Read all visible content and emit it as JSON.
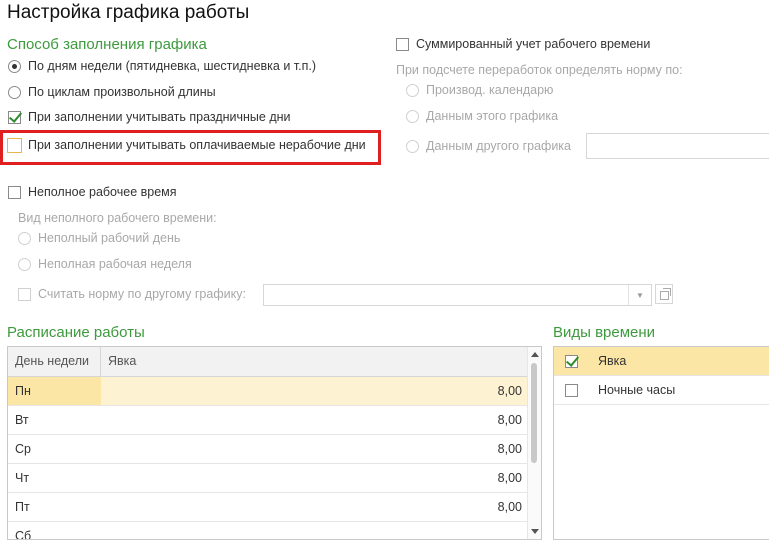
{
  "page": {
    "title": "Настройка графика работы"
  },
  "fill_method": {
    "heading": "Способ заполнения графика",
    "options": [
      {
        "label": "По дням недели (пятидневка, шестидневка и т.п.)",
        "selected": true
      },
      {
        "label": "По циклам произвольной длины",
        "selected": false
      }
    ],
    "holidays_checkbox": {
      "label": "При заполнении учитывать праздничные дни",
      "checked": true
    },
    "paid_nonworking_checkbox": {
      "label": "При заполнении учитывать оплачиваемые нерабочие дни",
      "checked": false
    }
  },
  "summary": {
    "checkbox": {
      "label": "Суммированный учет рабочего времени",
      "checked": false
    },
    "norm_caption": "При подсчете переработок определять норму по:",
    "options": [
      {
        "label": "Производ. календарю"
      },
      {
        "label": "Данным этого графика"
      },
      {
        "label": "Данным другого графика"
      }
    ],
    "other_schedule_value": ""
  },
  "part_time": {
    "checkbox": {
      "label": "Неполное рабочее время",
      "checked": false
    },
    "kind_caption": "Вид неполного рабочего времени:",
    "options": [
      {
        "label": "Неполный рабочий день"
      },
      {
        "label": "Неполная рабочая неделя"
      }
    ],
    "norm_checkbox": {
      "label": "Считать норму по другому графику:",
      "checked": false
    },
    "norm_schedule_value": ""
  },
  "schedule": {
    "heading": "Расписание работы",
    "columns": [
      "День недели",
      "Явка"
    ],
    "rows": [
      {
        "day": "Пн",
        "hours": "8,00"
      },
      {
        "day": "Вт",
        "hours": "8,00"
      },
      {
        "day": "Ср",
        "hours": "8,00"
      },
      {
        "day": "Чт",
        "hours": "8,00"
      },
      {
        "day": "Пт",
        "hours": "8,00"
      },
      {
        "day": "Сб",
        "hours": ""
      }
    ]
  },
  "time_kinds": {
    "heading": "Виды времени",
    "items": [
      {
        "label": "Явка",
        "checked": true
      },
      {
        "label": "Ночные часы",
        "checked": false
      }
    ]
  },
  "colors": {
    "section_heading": "#3d9a3d",
    "highlight_border": "#e02020",
    "active_row": "#fbe6a6",
    "check_mark": "#2e8b2e"
  }
}
